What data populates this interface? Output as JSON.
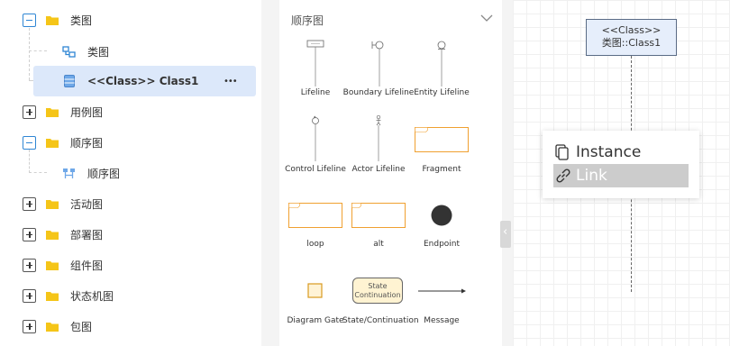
{
  "tree": {
    "class_diagram": "类图",
    "class_diagram_child": "类图",
    "selected_item": "<<Class>> Class1",
    "more": "•••",
    "use_case": "用例图",
    "sequence": "顺序图",
    "sequence_child": "顺序图",
    "activity": "活动图",
    "deployment": "部署图",
    "component": "组件图",
    "state_machine": "状态机图",
    "package": "包图"
  },
  "palette": {
    "title": "顺序图",
    "items": [
      {
        "label": "Lifeline"
      },
      {
        "label": "Boundary Lifeline"
      },
      {
        "label": "Entity Lifeline"
      },
      {
        "label": "Control Lifeline"
      },
      {
        "label": "Actor Lifeline"
      },
      {
        "label": "Fragment"
      },
      {
        "label": "loop"
      },
      {
        "label": "alt"
      },
      {
        "label": "Endpoint"
      },
      {
        "label": "Diagram Gate"
      },
      {
        "label": "State/Continuation"
      },
      {
        "label": "Message"
      }
    ],
    "state_box_text": "State Continuation"
  },
  "canvas": {
    "class_stereotype": "<<Class>>",
    "class_name": "类图::Class1",
    "menu": {
      "instance": "Instance",
      "link": "Link"
    }
  },
  "colors": {
    "folder": "#f5c518",
    "selected_bg": "#dce8fa",
    "accent": "#2f86d4",
    "fragment_border": "#f0a030"
  }
}
